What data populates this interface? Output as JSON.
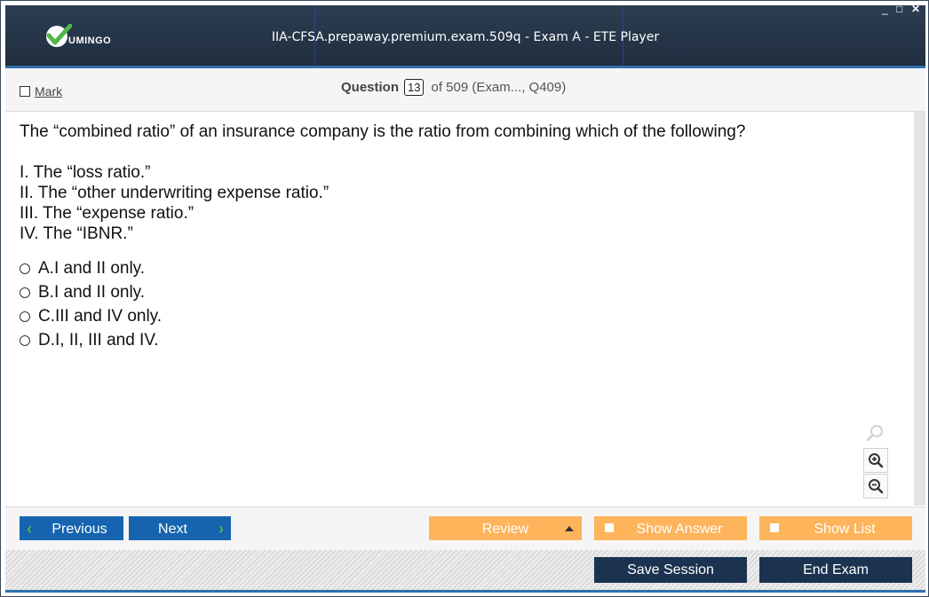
{
  "app": {
    "logo_text": "UMINGO",
    "window_title": "IIA-CFSA.prepaway.premium.exam.509q - Exam A - ETE Player",
    "controls": {
      "minimize": "_",
      "maximize": "□",
      "close": "✕"
    }
  },
  "header": {
    "mark_label": "Mark",
    "question_label": "Question",
    "question_number": "13",
    "question_of": "of 509 (Exam..., Q409)"
  },
  "question": {
    "stem": "The “combined ratio” of an insurance company is the ratio from combining which of the following?",
    "lines": [
      "I. The “loss ratio.”",
      "II. The “other underwriting expense ratio.”",
      "III. The “expense ratio.”",
      "IV. The “IBNR.”"
    ],
    "options": [
      {
        "letter": "A.",
        "text": "I and II only."
      },
      {
        "letter": "B.",
        "text": "I and II only."
      },
      {
        "letter": "C.",
        "text": "III and IV only."
      },
      {
        "letter": "D.",
        "text": "I, II, III and IV."
      }
    ]
  },
  "zoom": {
    "icons": [
      "search-icon",
      "zoom-in-icon",
      "zoom-out-icon"
    ]
  },
  "nav": {
    "previous": "Previous",
    "next": "Next",
    "review": "Review",
    "show_answer": "Show Answer",
    "show_list": "Show List"
  },
  "footer": {
    "save_session": "Save Session",
    "end_exam": "End Exam"
  },
  "colors": {
    "titlebar": "#1f2d3f",
    "accent_blue": "#1664b0",
    "accent_orange": "#fdb45a",
    "dark_button": "#1b3350",
    "chevron_green": "#4fb847"
  }
}
